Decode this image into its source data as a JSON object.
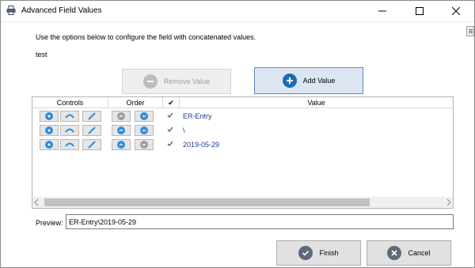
{
  "window": {
    "title": "Advanced Field Values",
    "icon": "printer-icon"
  },
  "main": {
    "instructions": "Use the options below to configure the field with concatenated values.",
    "field_name": "test"
  },
  "toolbar": {
    "remove_label": "Remove Value",
    "add_label": "Add Value"
  },
  "grid": {
    "headers": {
      "controls": "Controls",
      "order": "Order",
      "check": "✔",
      "value": "Value"
    },
    "rows": [
      {
        "value": "ER-Entry",
        "up_enabled": false,
        "down_enabled": true,
        "checked": true
      },
      {
        "value": "\\",
        "up_enabled": true,
        "down_enabled": true,
        "checked": true
      },
      {
        "value": "2019-05-29",
        "up_enabled": true,
        "down_enabled": false,
        "checked": true
      }
    ]
  },
  "preview": {
    "label": "Preview:",
    "value": "ER-Entry\\2019-05-29"
  },
  "footer": {
    "finish_label": "Finish",
    "cancel_label": "Cancel"
  },
  "colors": {
    "accent": "#1f6bb4",
    "row_text": "#1a3a8a",
    "enabled_icon": "#2f8ddc",
    "disabled_icon": "#9c9c9c"
  }
}
